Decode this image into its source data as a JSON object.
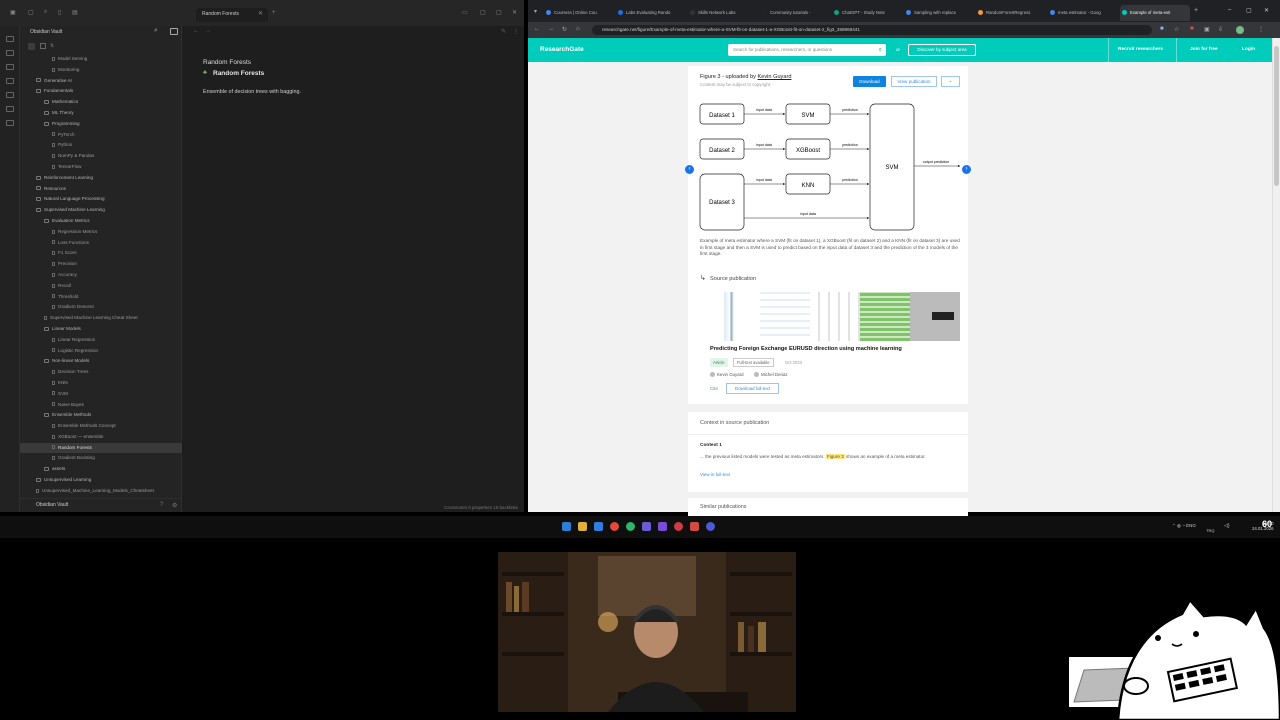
{
  "obsidian": {
    "tab_title": "Random Forests",
    "vault_name": "Obsidian Vault",
    "note": {
      "breadcrumb": "Random Forests",
      "title": "Random Forests",
      "body": "Ensemble of decision trees with bagging."
    },
    "status": "Crossnotes  0 properties  10 backlinks",
    "tree": [
      {
        "label": "Model Serving",
        "depth": 3,
        "type": "file"
      },
      {
        "label": "Monitoring",
        "depth": 3,
        "type": "file"
      },
      {
        "label": "Generative AI",
        "depth": 1,
        "type": "folder"
      },
      {
        "label": "Fundamentals",
        "depth": 1,
        "type": "folder"
      },
      {
        "label": "Mathematics",
        "depth": 2,
        "type": "folder"
      },
      {
        "label": "ML Theory",
        "depth": 2,
        "type": "folder"
      },
      {
        "label": "Programming",
        "depth": 2,
        "type": "folder"
      },
      {
        "label": "PyTorch",
        "depth": 3,
        "type": "file"
      },
      {
        "label": "Python",
        "depth": 3,
        "type": "file"
      },
      {
        "label": "NumPy & Pandas",
        "depth": 3,
        "type": "file"
      },
      {
        "label": "TensorFlow",
        "depth": 3,
        "type": "file"
      },
      {
        "label": "Reinforcement Learning",
        "depth": 1,
        "type": "folder"
      },
      {
        "label": "Resources",
        "depth": 1,
        "type": "folder"
      },
      {
        "label": "Natural Language Processing",
        "depth": 1,
        "type": "folder"
      },
      {
        "label": "Supervised Machine Learning",
        "depth": 1,
        "type": "folder"
      },
      {
        "label": "Evaluation Metrics",
        "depth": 2,
        "type": "folder"
      },
      {
        "label": "Regression Metrics",
        "depth": 3,
        "type": "file"
      },
      {
        "label": "Loss Functions",
        "depth": 3,
        "type": "file"
      },
      {
        "label": "F1 Score",
        "depth": 3,
        "type": "file"
      },
      {
        "label": "Precision",
        "depth": 3,
        "type": "file"
      },
      {
        "label": "Accuracy",
        "depth": 3,
        "type": "file"
      },
      {
        "label": "Recall",
        "depth": 3,
        "type": "file"
      },
      {
        "label": "Threshold",
        "depth": 3,
        "type": "file"
      },
      {
        "label": "Gradient Descent",
        "depth": 3,
        "type": "file"
      },
      {
        "label": "Supervised Machine Learning Cheat Sheet",
        "depth": 2,
        "type": "file"
      },
      {
        "label": "Linear Models",
        "depth": 2,
        "type": "folder"
      },
      {
        "label": "Linear Regression",
        "depth": 3,
        "type": "file"
      },
      {
        "label": "Logistic Regression",
        "depth": 3,
        "type": "file"
      },
      {
        "label": "Non-linear Models",
        "depth": 2,
        "type": "folder"
      },
      {
        "label": "Decision Trees",
        "depth": 3,
        "type": "file"
      },
      {
        "label": "KNN",
        "depth": 3,
        "type": "file"
      },
      {
        "label": "SVM",
        "depth": 3,
        "type": "file"
      },
      {
        "label": "Naive Bayes",
        "depth": 3,
        "type": "file"
      },
      {
        "label": "Ensemble Methods",
        "depth": 2,
        "type": "folder"
      },
      {
        "label": "Ensemble Methods Concept",
        "depth": 3,
        "type": "file"
      },
      {
        "label": "XGBoost — ensemble",
        "depth": 3,
        "type": "file"
      },
      {
        "label": "Random Forests",
        "depth": 3,
        "type": "file",
        "active": true
      },
      {
        "label": "Gradient Boosting",
        "depth": 3,
        "type": "file"
      },
      {
        "label": "assets",
        "depth": 2,
        "type": "folder"
      },
      {
        "label": "Unsupervised Learning",
        "depth": 1,
        "type": "folder"
      },
      {
        "label": "Unsupervised_Machine_Learning_Models_Cheatsheet",
        "depth": 1,
        "type": "file"
      }
    ]
  },
  "browser": {
    "tabs": [
      {
        "label": "Coursera | Online Cou",
        "color": "#4285f4"
      },
      {
        "label": "Labs Evaluating Rando",
        "color": "#1a73e8"
      },
      {
        "label": "Skills Network Labs",
        "color": "#333333"
      },
      {
        "label": "Community tutorials -",
        "color": "#222222"
      },
      {
        "label": "ChatGPT - Study Note",
        "color": "#10a37f"
      },
      {
        "label": "Sampling with replace",
        "color": "#4285f4"
      },
      {
        "label": "RandomForestRegress",
        "color": "#f89939"
      },
      {
        "label": "meta estimator - Goog",
        "color": "#4285f4"
      },
      {
        "label": "Example of meta-esti",
        "color": "#00ccbb",
        "active": true
      }
    ],
    "url": "researchgate.net/figure/Example-of-meta-estimator-where-a-SVM-fit-on-dataset-1-a-XGBoost-fit-on-dataset-2_fig3_358969441",
    "rg": {
      "logo": "ResearchGate",
      "search_placeholder": "Search for publications, researchers, or questions",
      "or": "or",
      "discover": "Discover by subject area",
      "recruit": "Recruit researchers",
      "join": "Join for free",
      "login": "Login"
    },
    "figure": {
      "title_prefix": "Figure 3 - uploaded by",
      "author": "Kevin Guyard",
      "subtitle": "Content may be subject to copyright.",
      "download": "Download",
      "view_publication": "View publication",
      "more": "⌄",
      "caption": "Example of meta estimator where a SVM (fit on dataset 1), a XGBoost (fit on dataset 2) and a KNN (fit on dataset 3) are used in first stage and then a SVM is used to predict based on the input data of dataset 3 and the prediction of the 3 models of the first stage.",
      "diagram": {
        "datasets": [
          "Dataset 1",
          "Dataset 2",
          "Dataset 3"
        ],
        "models": [
          "SVM",
          "XGBoost",
          "KNN"
        ],
        "meta": "SVM",
        "input_label": "input data",
        "prediction_label": "prediction",
        "output_label": "output prediction"
      }
    },
    "source": {
      "heading": "Source publication",
      "paper_title": "Predicting Foreign Exchange EURUSD direction using machine learning",
      "tag_article": "Article",
      "tag_fulltext": "Full-text available",
      "date": "Oct 2023",
      "authors": [
        "Kevin Guyard",
        "Michel Deriaz"
      ],
      "cite": "Cite",
      "download_fulltext": "Download full-text"
    },
    "context": {
      "heading": "Context in source publication",
      "label": "Context 1",
      "text_before": "... the previous listed models were tested as meta estimators.",
      "highlight": "Figure 3",
      "text_after": "shows an example of a meta estimator.",
      "view": "View in full-text"
    },
    "similar": {
      "heading": "Similar publications"
    }
  },
  "taskbar": {
    "lang1": "ENG",
    "lang2": "TRQ",
    "time": "18:00",
    "date": "24.01.2026",
    "badge": "60"
  }
}
